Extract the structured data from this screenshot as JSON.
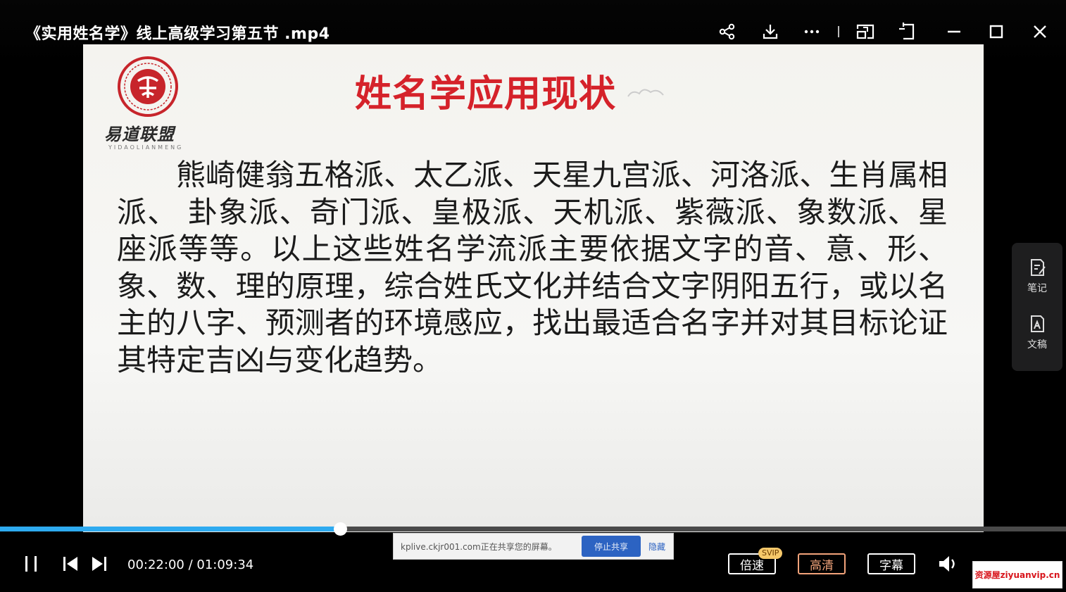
{
  "window": {
    "title": "《实用姓名学》线上高级学习第五节 .mp4",
    "buttons": [
      "share",
      "download",
      "more",
      "picture-in-picture",
      "pin",
      "minimize",
      "maximize",
      "close"
    ]
  },
  "slide": {
    "logo_text": "易道联盟",
    "logo_sub": "YIDAOLIANMENG",
    "title": "姓名学应用现状",
    "body": "熊崎健翁五格派、太乙派、天星九宫派、河洛派、生肖属相派、 卦象派、奇门派、皇极派、天机派、紫薇派、象数派、星座派等等。以上这些姓名学流派主要依据文字的音、意、形、象、数、理的原理，综合姓氏文化并结合文字阴阳五行，或以名主的八字、预测者的环境感应，找出最适合名字并对其目标论证其特定吉凶与变化趋势。",
    "accent_color": "#d5222a"
  },
  "side_panel": {
    "notes_label": "笔记",
    "transcript_label": "文稿"
  },
  "player": {
    "progress": 0.319,
    "current_time": "00:22:00",
    "separator": "/",
    "total_time": "01:09:34",
    "speed_label": "倍速",
    "svip_badge": "SVIP",
    "quality_label": "高清",
    "subtitle_label": "字幕",
    "progress_color": "#2eaaf0"
  },
  "share_notice": {
    "text": "kplive.ckjr001.com正在共享您的屏幕。",
    "stop_label": "停止共享",
    "hide_label": "隐藏"
  },
  "watermark": "资源屋ziyuanvip.cn"
}
